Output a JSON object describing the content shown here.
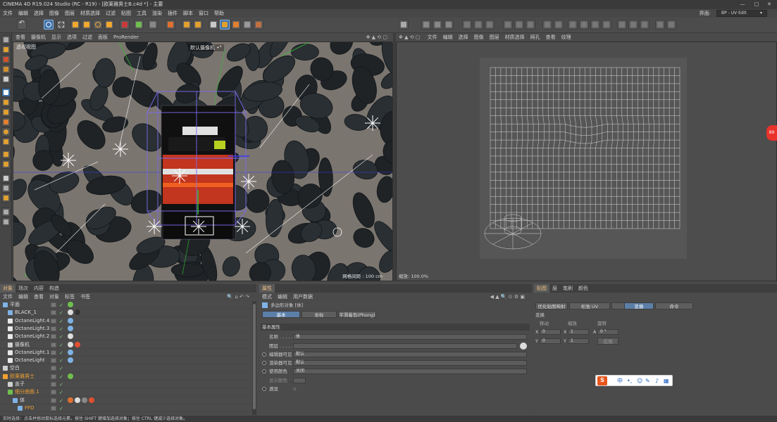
{
  "window": {
    "title": "CINEMA 4D R19.024 Studio (RC - R19) - [欧莱雅男士B.c4d *] - 主要",
    "controls": [
      "—",
      "□",
      "✕"
    ]
  },
  "menubar": {
    "items": [
      "文件",
      "编辑",
      "选择",
      "图像",
      "图层",
      "材质选择",
      "过滤",
      "贴图",
      "工具",
      "渲染",
      "插件",
      "脚本",
      "窗口",
      "帮助"
    ],
    "layout_label": "界面:",
    "layout_value": "BP - UV Edit"
  },
  "viewport": {
    "menu": [
      "查看",
      "摄像机",
      "显示",
      "选项",
      "过滤",
      "面板",
      "ProRender"
    ],
    "name": "透视视图",
    "camera": "默认摄像机 •°",
    "grid_readout": "网格间距 : 100 cm"
  },
  "uv_editor": {
    "menu": [
      "文件",
      "编辑",
      "选择",
      "图像",
      "图层",
      "材质选择",
      "网孔",
      "查看",
      "纹理"
    ],
    "zoom_readout": "缩放: 100.0%"
  },
  "object_manager": {
    "tabs": [
      "对象",
      "场次",
      "内容浏览器",
      "构造"
    ],
    "tabs_short": [
      "对象",
      "场次",
      "内容",
      "构造"
    ],
    "menu": [
      "文件",
      "编辑",
      "查看",
      "对象",
      "标签",
      "书签"
    ],
    "rows": [
      {
        "name": "平面",
        "indent": 0,
        "icon_color": "#7fb2e5"
      },
      {
        "name": "BLACK_1",
        "indent": 1,
        "icon_color": "#7fb2e5"
      },
      {
        "name": "OctaneLight.4",
        "indent": 1,
        "icon_color": "#e8e8e8"
      },
      {
        "name": "OctaneLight.3",
        "indent": 1,
        "icon_color": "#e8e8e8"
      },
      {
        "name": "OctaneLight.2",
        "indent": 1,
        "icon_color": "#e8e8e8"
      },
      {
        "name": "摄像机",
        "indent": 1,
        "icon_color": "#d0d0d0"
      },
      {
        "name": "OctaneLight.1",
        "indent": 1,
        "icon_color": "#e8e8e8"
      },
      {
        "name": "OctaneLight",
        "indent": 1,
        "icon_color": "#e8e8e8"
      },
      {
        "name": "空白",
        "indent": 0,
        "icon_color": "#d0d0d0"
      },
      {
        "name": "欧莱雅男士",
        "indent": 0,
        "icon_color": "#f0a030",
        "highlight": true
      },
      {
        "name": "盖子",
        "indent": 1,
        "icon_color": "#d0d0d0"
      },
      {
        "name": "细分曲面.1",
        "indent": 1,
        "icon_color": "#6fbf4f",
        "highlight": true
      },
      {
        "name": "体",
        "indent": 2,
        "icon_color": "#7fb2e5"
      },
      {
        "name": "FFD",
        "indent": 3,
        "icon_color": "#7fb2e5",
        "highlight": true
      }
    ]
  },
  "attributes": {
    "tabs": [
      "属性"
    ],
    "menu": [
      "模式",
      "编辑",
      "用户数据"
    ],
    "object_header": "多边形对象 [体]",
    "subtabs": [
      "基本",
      "坐标",
      "平滑着色(Phong)"
    ],
    "section": "基本属性",
    "fields": [
      {
        "label": "名称 . . . . . .",
        "value": "体"
      },
      {
        "label": "图层 . . . . . .",
        "value": ""
      },
      {
        "label": "编辑器可见",
        "value": "默认"
      },
      {
        "label": "渲染器可见",
        "value": "默认"
      },
      {
        "label": "使用颜色",
        "value": "关闭"
      },
      {
        "label": "显示颜色",
        "value": ""
      },
      {
        "label": "透显",
        "value": ""
      }
    ]
  },
  "uv_manager": {
    "tabs": [
      "贴图",
      "层",
      "笔刷",
      "颜色"
    ],
    "buttons": [
      "优化贴图映射",
      "松弛 UV",
      "投射",
      "变换",
      "命令"
    ],
    "section": "变换",
    "col_headers": [
      "移动",
      "缩放",
      "旋转"
    ],
    "rows": [
      {
        "axis": "X",
        "move": "0",
        "scale_axis": "X",
        "scale": "1",
        "rot_axis": "A",
        "rot": "0 °"
      },
      {
        "axis": "Y",
        "move": "0",
        "scale_axis": "Y",
        "scale": "1"
      }
    ],
    "apply_label": "应用"
  },
  "ime": {
    "label": "中"
  },
  "status": {
    "text": "实时选择：点击并拖动鼠标选择元素。按住 SHIFT 键增加选择对象；按住 CTRL 键减少选择对象。"
  },
  "colors": {
    "selected_blue": "#3c6fa6",
    "highlight_orange": "#f0a030",
    "uv_mesh": "#d8d8d8",
    "cage_purple": "#7a6cf0"
  }
}
